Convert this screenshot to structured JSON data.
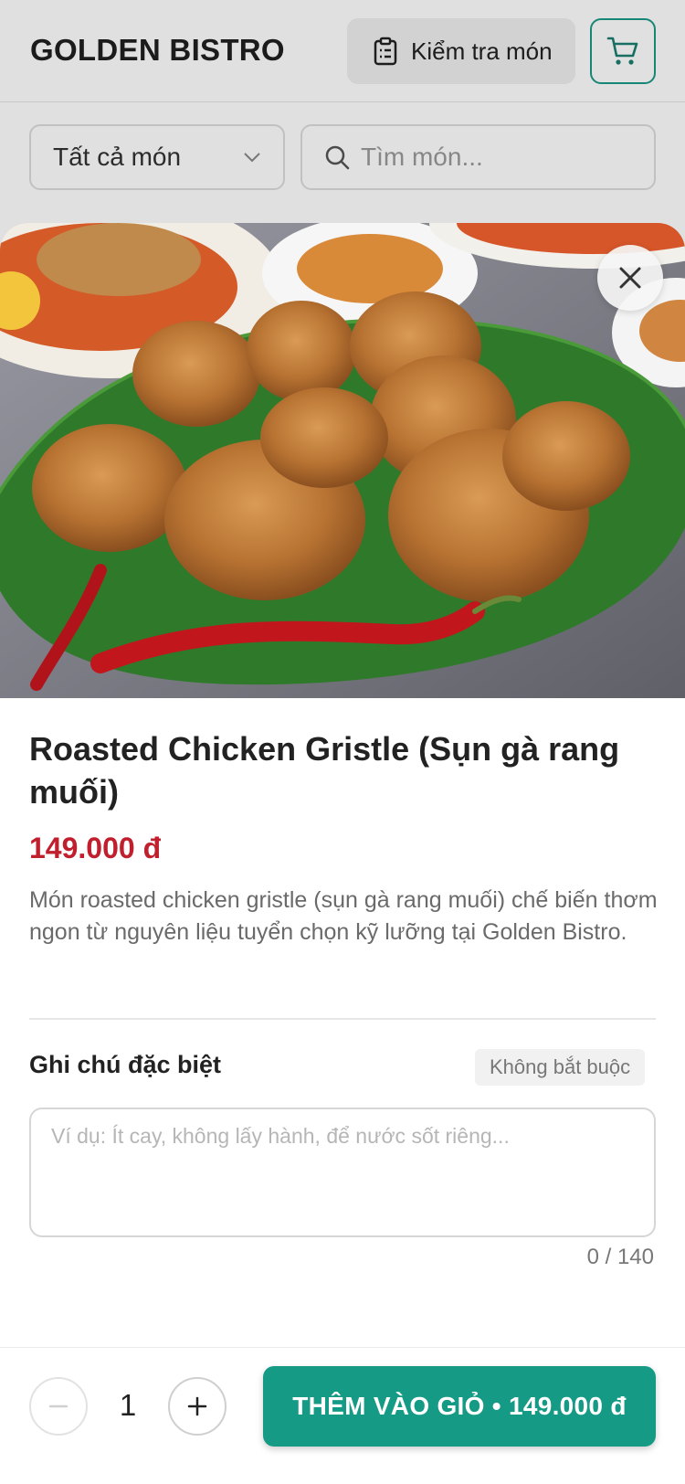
{
  "header": {
    "brand": "GOLDEN BISTRO",
    "check_order_label": "Kiểm tra món",
    "cart_icon": "cart-icon"
  },
  "filters": {
    "category_selected": "Tất cả món",
    "search_placeholder": "Tìm món..."
  },
  "item": {
    "name": "Roasted Chicken Gristle (Sụn gà rang muối)",
    "price": "149.000 đ",
    "description": "Món roasted chicken gristle (sụn gà rang muối) chế biến thơm ngon từ nguyên liệu tuyển chọn kỹ lưỡng tại Golden Bistro."
  },
  "note": {
    "label": "Ghi chú đặc biệt",
    "optional_badge": "Không bắt buộc",
    "placeholder": "Ví dụ: Ít cay, không lấy hành, để nước sốt riêng...",
    "value": "",
    "counter": "0 / 140"
  },
  "footer": {
    "quantity": "1",
    "add_label": "THÊM VÀO GIỎ • 149.000 đ"
  },
  "colors": {
    "accent": "#159a86",
    "price": "#c0202d"
  }
}
